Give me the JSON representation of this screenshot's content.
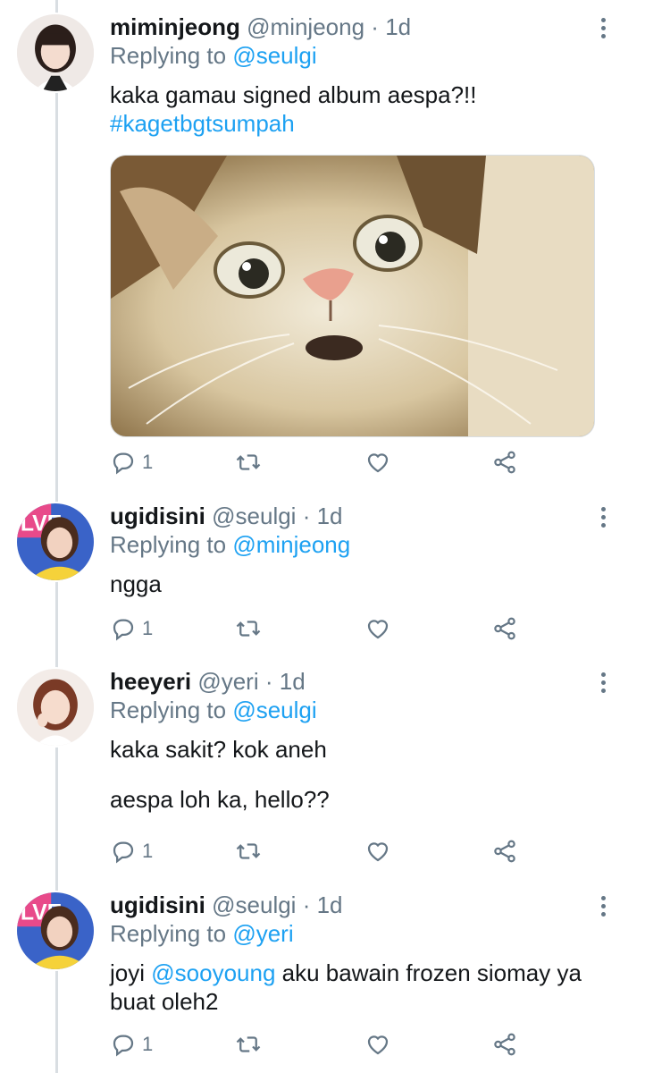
{
  "tweets": [
    {
      "name": "miminjeong",
      "handle": "@minjeong",
      "dot": "·",
      "time": "1d",
      "replying_prefix": "Replying to ",
      "replying_to": "@seulgi",
      "text": "kaka gamau signed album aespa?!!",
      "hashtag": "#kagetbgtsumpah",
      "has_media": true,
      "replies": "1"
    },
    {
      "name": "ugidisini",
      "handle": "@seulgi",
      "dot": "·",
      "time": "1d",
      "replying_prefix": "Replying to ",
      "replying_to": "@minjeong",
      "text": "ngga",
      "replies": "1"
    },
    {
      "name": "heeyeri",
      "handle": "@yeri",
      "dot": "·",
      "time": "1d",
      "replying_prefix": "Replying to ",
      "replying_to": "@seulgi",
      "text_line1": "kaka sakit? kok aneh",
      "text_line2": "aespa loh ka, hello??",
      "replies": "1"
    },
    {
      "name": "ugidisini",
      "handle": "@seulgi",
      "dot": "·",
      "time": "1d",
      "replying_prefix": "Replying to ",
      "replying_to": "@yeri",
      "text_before": "joyi ",
      "text_mention": "@sooyoung",
      "text_after": " aku bawain frozen siomay ya buat oleh2",
      "replies": "1"
    }
  ],
  "icons": {
    "reply": "reply-icon",
    "retweet": "retweet-icon",
    "like": "like-icon",
    "share": "share-icon",
    "more": "more-icon"
  },
  "colors": {
    "link": "#1da1f2",
    "secondary": "#657786",
    "thread": "#d9dee2"
  }
}
